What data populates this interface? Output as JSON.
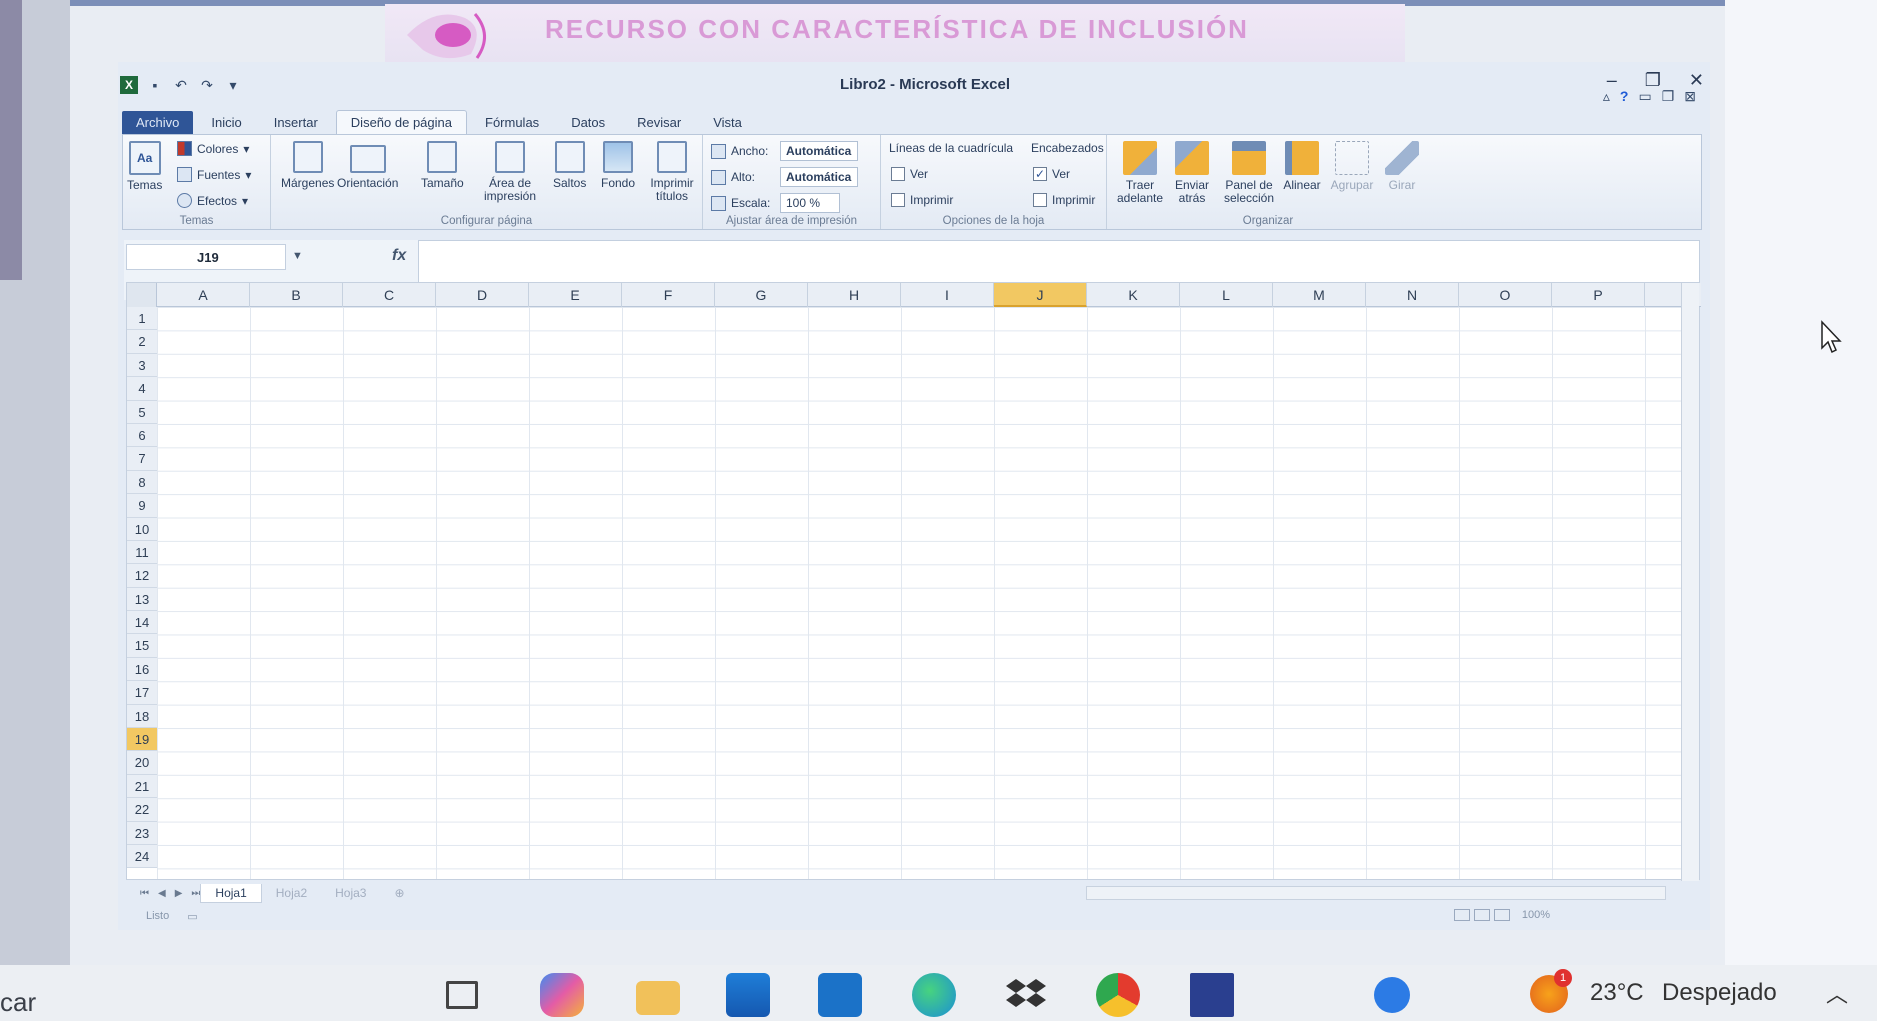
{
  "banner": {
    "text": "RECURSO CON CARACTERÍSTICA DE INCLUSIÓN"
  },
  "window": {
    "title": "Libro2 - Microsoft Excel",
    "minimize": "–",
    "restore": "❐",
    "close": "✕"
  },
  "tabs": [
    "Archivo",
    "Inicio",
    "Insertar",
    "Diseño de página",
    "Fórmulas",
    "Datos",
    "Revisar",
    "Vista"
  ],
  "ribbon": {
    "temas": {
      "label": "Temas",
      "button": "Temas",
      "colores": "Colores",
      "fuentes": "Fuentes",
      "efectos": "Efectos"
    },
    "configurar": {
      "label": "Configurar página",
      "margenes": "Márgenes",
      "orientacion": "Orientación",
      "tamano": "Tamaño",
      "area": "Área de impresión",
      "saltos": "Saltos",
      "fondo": "Fondo",
      "imprimir_titulos": "Imprimir títulos"
    },
    "ajustar": {
      "label": "Ajustar área de impresión",
      "ancho_label": "Ancho:",
      "ancho_value": "Automática",
      "alto_label": "Alto:",
      "alto_value": "Automática",
      "escala_label": "Escala:",
      "escala_value": "100 %"
    },
    "opciones": {
      "label": "Opciones de la hoja",
      "lineas": "Líneas de la cuadrícula",
      "encabezados": "Encabezados",
      "ver": "Ver",
      "imprimir": "Imprimir"
    },
    "organizar": {
      "label": "Organizar",
      "traer": "Traer adelante",
      "enviar": "Enviar atrás",
      "panel": "Panel de selección",
      "alinear": "Alinear",
      "agrupar": "Agrupar",
      "girar": "Girar"
    }
  },
  "formula": {
    "namebox": "J19",
    "fx": "fx"
  },
  "columns": [
    "A",
    "B",
    "C",
    "D",
    "E",
    "F",
    "G",
    "H",
    "I",
    "J",
    "K",
    "L",
    "M",
    "N",
    "O",
    "P"
  ],
  "selected_column": "J",
  "rows": [
    "1",
    "2",
    "3",
    "4",
    "5",
    "6",
    "7",
    "8",
    "9",
    "10",
    "11",
    "12",
    "13",
    "14",
    "15",
    "16",
    "17",
    "18",
    "19",
    "20",
    "21",
    "22",
    "23",
    "24"
  ],
  "selected_row": "19",
  "sheets": [
    "Hoja1",
    "Hoja2",
    "Hoja3"
  ],
  "status": {
    "ready": "Listo",
    "zoom": "100%"
  },
  "taskbar": {
    "search_fragment": "car",
    "temperature": "23°C",
    "weather": "Despejado",
    "badge": "1"
  },
  "colors": {
    "excel_file_tab": "#2f5597",
    "selection": "#f2c862",
    "banner_text": "#d99ad6"
  }
}
